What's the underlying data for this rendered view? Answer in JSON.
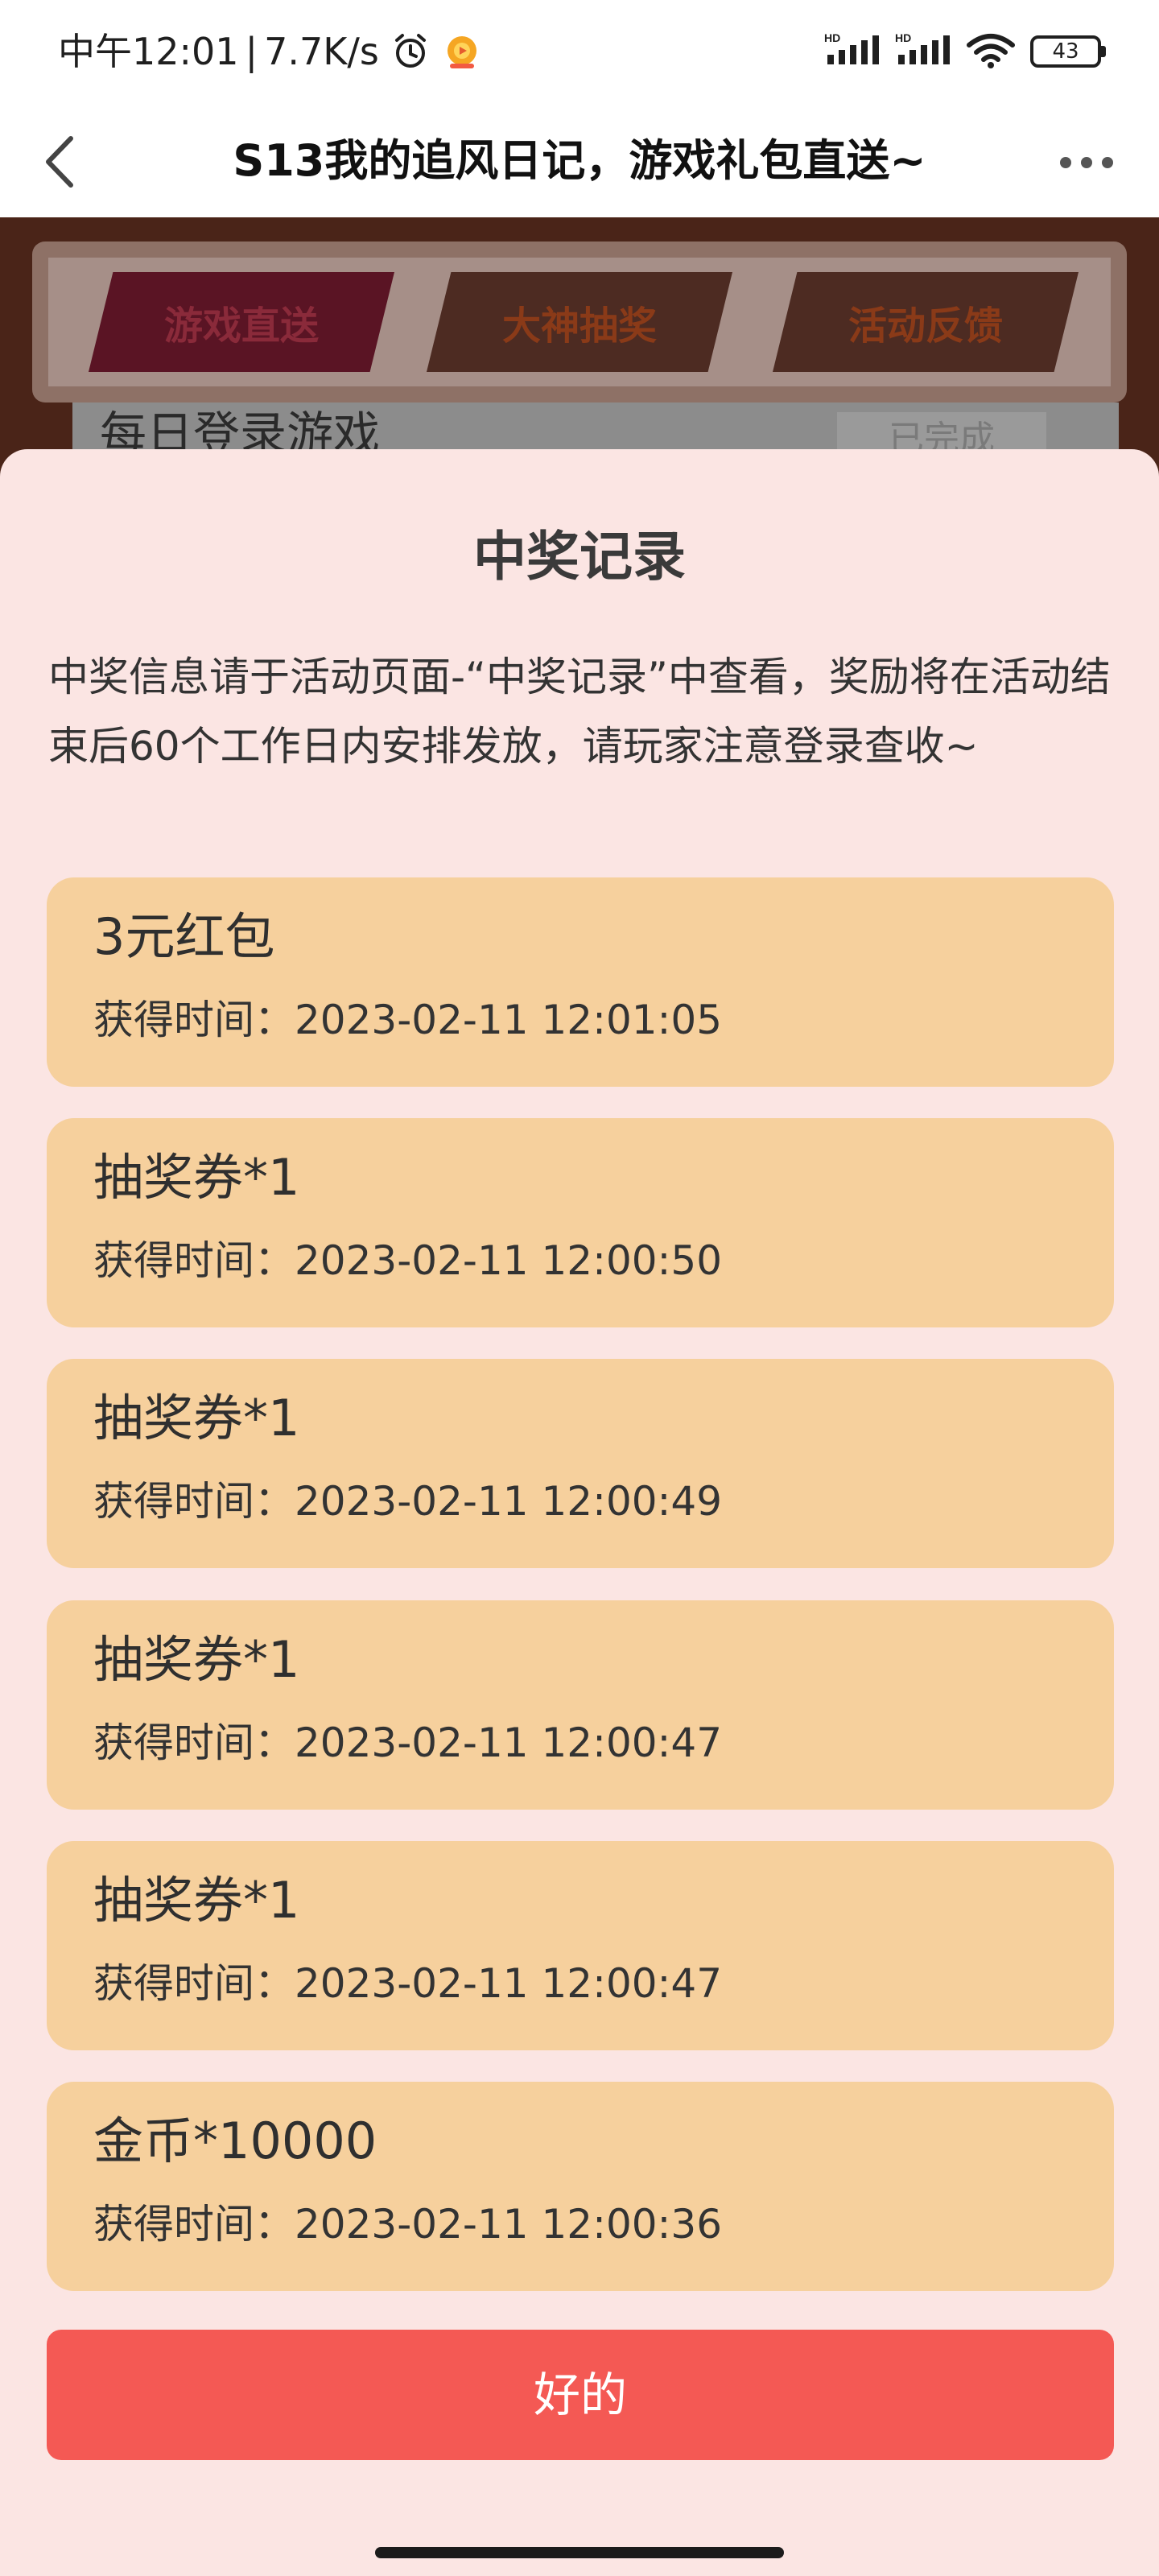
{
  "status_bar": {
    "time": "中午12:01",
    "network_speed": "7.7K/s",
    "alarm_icon": "alarm-clock-icon",
    "app_icon": "game-app-icon",
    "signal_1": "HD",
    "signal_2": "HD",
    "wifi_icon": "wifi-icon",
    "battery": "43"
  },
  "header": {
    "back_icon": "chevron-left-icon",
    "title": "S13我的追风日记，游戏礼包直送~",
    "more_icon": "more-dots-icon"
  },
  "background_page": {
    "tabs": [
      {
        "label": "游戏直送",
        "active": true
      },
      {
        "label": "大神抽奖",
        "active": false
      },
      {
        "label": "活动反馈",
        "active": false
      }
    ],
    "task": {
      "label": "每日登录游戏",
      "status": "已完成"
    }
  },
  "modal": {
    "title": "中奖记录",
    "note": "中奖信息请于活动页面-“中奖记录”中查看，奖励将在活动结束后60个工作日内安排发放，请玩家注意登录查收~",
    "records": [
      {
        "name": "3元红包",
        "time": "获得时间：2023-02-11 12:01:05"
      },
      {
        "name": "抽奖券*1",
        "time": "获得时间：2023-02-11 12:00:50"
      },
      {
        "name": "抽奖券*1",
        "time": "获得时间：2023-02-11 12:00:49"
      },
      {
        "name": "抽奖券*1",
        "time": "获得时间：2023-02-11 12:00:47"
      },
      {
        "name": "抽奖券*1",
        "time": "获得时间：2023-02-11 12:00:47"
      },
      {
        "name": "金币*10000",
        "time": "获得时间：2023-02-11 12:00:36"
      }
    ],
    "ok_label": "好的"
  },
  "colors": {
    "modal_background": "#fbe5e3",
    "card_background": "#f6d09d",
    "primary_button": "#f45954"
  }
}
